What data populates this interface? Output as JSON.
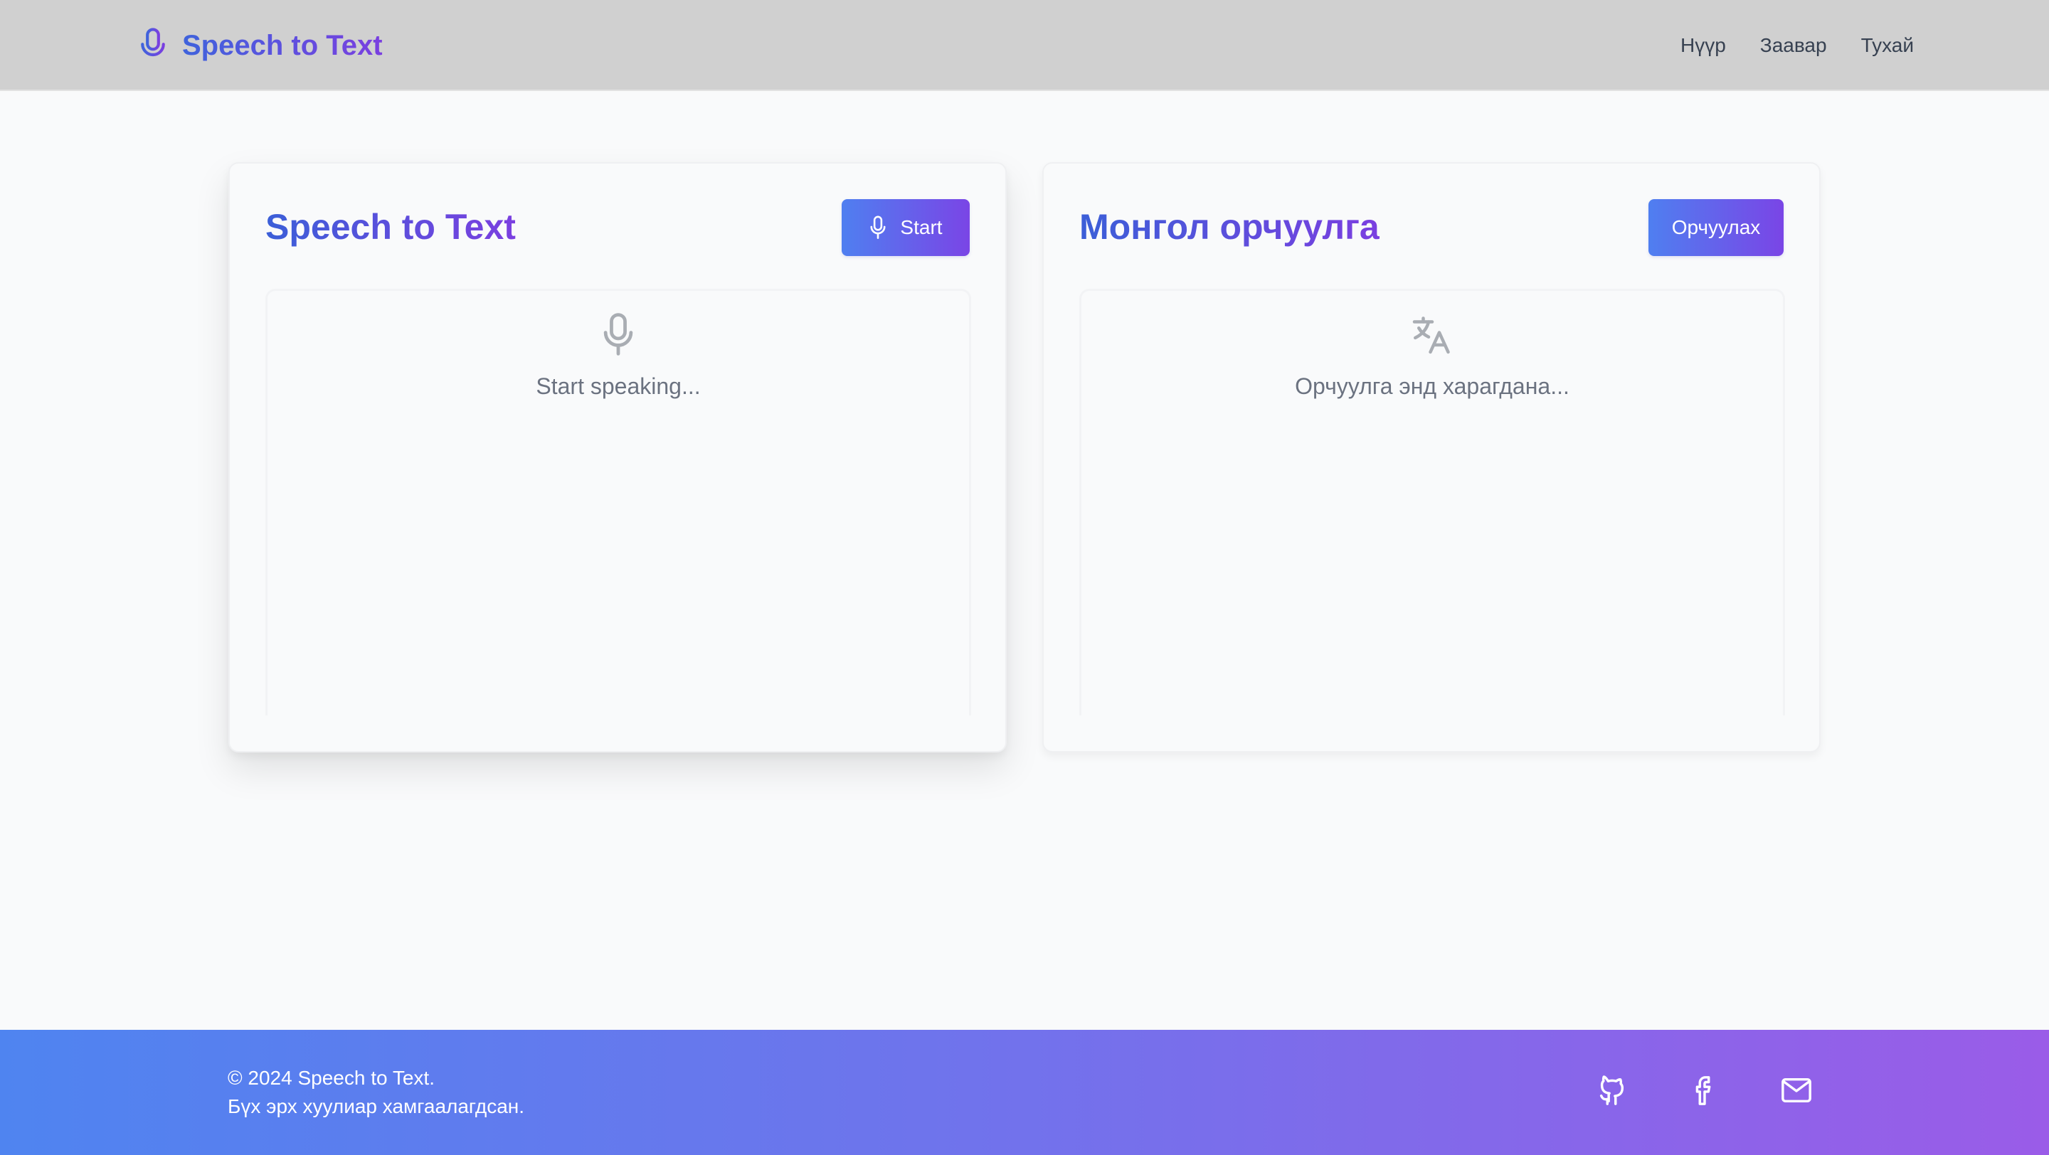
{
  "header": {
    "brand": "Speech to Text",
    "brand_icon": "microphone-icon",
    "nav": [
      {
        "label": "Нүүр"
      },
      {
        "label": "Заавар"
      },
      {
        "label": "Тухай"
      }
    ]
  },
  "speech_card": {
    "title": "Speech to Text",
    "button_label": "Start",
    "button_icon": "microphone-icon",
    "placeholder": "Start speaking...",
    "placeholder_icon": "microphone-icon"
  },
  "translate_card": {
    "title": "Монгол орчуулга",
    "button_label": "Орчуулах",
    "placeholder": "Орчуулга энд харагдана...",
    "placeholder_icon": "translate-icon"
  },
  "footer": {
    "copyright": "© 2024 Speech to Text.",
    "rights": "Бүх эрх хуулиар хамгаалагдсан.",
    "social_icons": [
      "github-icon",
      "facebook-icon",
      "mail-icon"
    ]
  },
  "colors": {
    "header_bg": "#d0d0d0",
    "accent_start": "#4f7ff0",
    "accent_end": "#7a45e6",
    "page_bg": "#f9fafb",
    "muted_text": "#6b7280"
  }
}
